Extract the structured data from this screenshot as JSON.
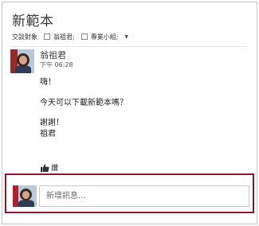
{
  "conversation": {
    "title": "新範本",
    "participants_label": "交談對象",
    "participants": [
      {
        "name": "翁祖君;"
      },
      {
        "name": "專業小組;"
      }
    ]
  },
  "message": {
    "sender": "翁祖君",
    "time": "下午 06:28",
    "lines": [
      "嗨！",
      "今天可以下載新範本嗎？",
      "謝謝！",
      "祖君"
    ],
    "like_label": "讚"
  },
  "compose": {
    "placeholder": "新增訊息..."
  },
  "colors": {
    "highlight_border": "#8c1a2a"
  }
}
